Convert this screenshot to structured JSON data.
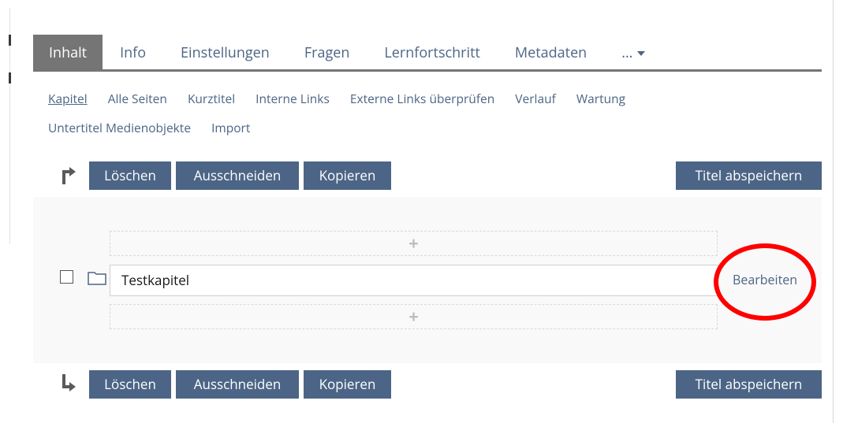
{
  "tabs": [
    {
      "label": "Inhalt"
    },
    {
      "label": "Info"
    },
    {
      "label": "Einstellungen"
    },
    {
      "label": "Fragen"
    },
    {
      "label": "Lernfortschritt"
    },
    {
      "label": "Metadaten"
    },
    {
      "label": "..."
    }
  ],
  "subtabs": [
    {
      "label": "Kapitel"
    },
    {
      "label": "Alle Seiten"
    },
    {
      "label": "Kurztitel"
    },
    {
      "label": "Interne Links"
    },
    {
      "label": "Externe Links überprüfen"
    },
    {
      "label": "Verlauf"
    },
    {
      "label": "Wartung"
    },
    {
      "label": "Untertitel Medienobjekte"
    },
    {
      "label": "Import"
    }
  ],
  "toolbar": {
    "delete_label": "Löschen",
    "cut_label": "Ausschneiden",
    "copy_label": "Kopieren",
    "save_titles_label": "Titel abspeichern"
  },
  "chapter": {
    "title": "Testkapitel",
    "edit_label": "Bearbeiten",
    "add_symbol": "+"
  },
  "colors": {
    "accent": "#4c6586",
    "active_tab": "#757575",
    "highlight": "#ff0000"
  }
}
